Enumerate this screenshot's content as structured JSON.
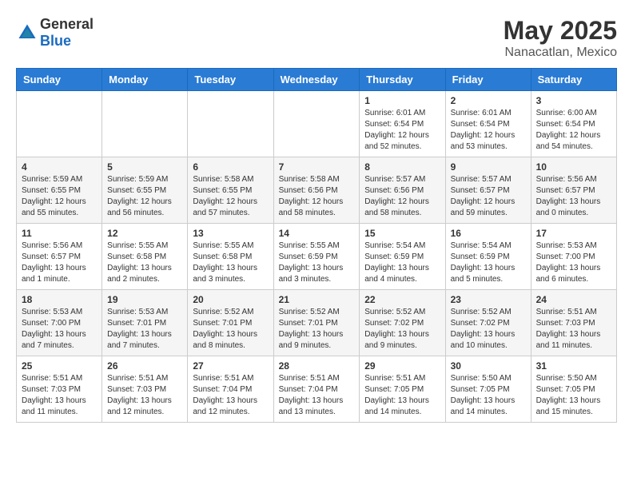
{
  "header": {
    "logo": {
      "general": "General",
      "blue": "Blue"
    },
    "title": "May 2025",
    "location": "Nanacatlan, Mexico"
  },
  "calendar": {
    "days_of_week": [
      "Sunday",
      "Monday",
      "Tuesday",
      "Wednesday",
      "Thursday",
      "Friday",
      "Saturday"
    ],
    "weeks": [
      [
        {
          "day": "",
          "info": ""
        },
        {
          "day": "",
          "info": ""
        },
        {
          "day": "",
          "info": ""
        },
        {
          "day": "",
          "info": ""
        },
        {
          "day": "1",
          "info": "Sunrise: 6:01 AM\nSunset: 6:54 PM\nDaylight: 12 hours\nand 52 minutes."
        },
        {
          "day": "2",
          "info": "Sunrise: 6:01 AM\nSunset: 6:54 PM\nDaylight: 12 hours\nand 53 minutes."
        },
        {
          "day": "3",
          "info": "Sunrise: 6:00 AM\nSunset: 6:54 PM\nDaylight: 12 hours\nand 54 minutes."
        }
      ],
      [
        {
          "day": "4",
          "info": "Sunrise: 5:59 AM\nSunset: 6:55 PM\nDaylight: 12 hours\nand 55 minutes."
        },
        {
          "day": "5",
          "info": "Sunrise: 5:59 AM\nSunset: 6:55 PM\nDaylight: 12 hours\nand 56 minutes."
        },
        {
          "day": "6",
          "info": "Sunrise: 5:58 AM\nSunset: 6:55 PM\nDaylight: 12 hours\nand 57 minutes."
        },
        {
          "day": "7",
          "info": "Sunrise: 5:58 AM\nSunset: 6:56 PM\nDaylight: 12 hours\nand 58 minutes."
        },
        {
          "day": "8",
          "info": "Sunrise: 5:57 AM\nSunset: 6:56 PM\nDaylight: 12 hours\nand 58 minutes."
        },
        {
          "day": "9",
          "info": "Sunrise: 5:57 AM\nSunset: 6:57 PM\nDaylight: 12 hours\nand 59 minutes."
        },
        {
          "day": "10",
          "info": "Sunrise: 5:56 AM\nSunset: 6:57 PM\nDaylight: 13 hours\nand 0 minutes."
        }
      ],
      [
        {
          "day": "11",
          "info": "Sunrise: 5:56 AM\nSunset: 6:57 PM\nDaylight: 13 hours\nand 1 minute."
        },
        {
          "day": "12",
          "info": "Sunrise: 5:55 AM\nSunset: 6:58 PM\nDaylight: 13 hours\nand 2 minutes."
        },
        {
          "day": "13",
          "info": "Sunrise: 5:55 AM\nSunset: 6:58 PM\nDaylight: 13 hours\nand 3 minutes."
        },
        {
          "day": "14",
          "info": "Sunrise: 5:55 AM\nSunset: 6:59 PM\nDaylight: 13 hours\nand 3 minutes."
        },
        {
          "day": "15",
          "info": "Sunrise: 5:54 AM\nSunset: 6:59 PM\nDaylight: 13 hours\nand 4 minutes."
        },
        {
          "day": "16",
          "info": "Sunrise: 5:54 AM\nSunset: 6:59 PM\nDaylight: 13 hours\nand 5 minutes."
        },
        {
          "day": "17",
          "info": "Sunrise: 5:53 AM\nSunset: 7:00 PM\nDaylight: 13 hours\nand 6 minutes."
        }
      ],
      [
        {
          "day": "18",
          "info": "Sunrise: 5:53 AM\nSunset: 7:00 PM\nDaylight: 13 hours\nand 7 minutes."
        },
        {
          "day": "19",
          "info": "Sunrise: 5:53 AM\nSunset: 7:01 PM\nDaylight: 13 hours\nand 7 minutes."
        },
        {
          "day": "20",
          "info": "Sunrise: 5:52 AM\nSunset: 7:01 PM\nDaylight: 13 hours\nand 8 minutes."
        },
        {
          "day": "21",
          "info": "Sunrise: 5:52 AM\nSunset: 7:01 PM\nDaylight: 13 hours\nand 9 minutes."
        },
        {
          "day": "22",
          "info": "Sunrise: 5:52 AM\nSunset: 7:02 PM\nDaylight: 13 hours\nand 9 minutes."
        },
        {
          "day": "23",
          "info": "Sunrise: 5:52 AM\nSunset: 7:02 PM\nDaylight: 13 hours\nand 10 minutes."
        },
        {
          "day": "24",
          "info": "Sunrise: 5:51 AM\nSunset: 7:03 PM\nDaylight: 13 hours\nand 11 minutes."
        }
      ],
      [
        {
          "day": "25",
          "info": "Sunrise: 5:51 AM\nSunset: 7:03 PM\nDaylight: 13 hours\nand 11 minutes."
        },
        {
          "day": "26",
          "info": "Sunrise: 5:51 AM\nSunset: 7:03 PM\nDaylight: 13 hours\nand 12 minutes."
        },
        {
          "day": "27",
          "info": "Sunrise: 5:51 AM\nSunset: 7:04 PM\nDaylight: 13 hours\nand 12 minutes."
        },
        {
          "day": "28",
          "info": "Sunrise: 5:51 AM\nSunset: 7:04 PM\nDaylight: 13 hours\nand 13 minutes."
        },
        {
          "day": "29",
          "info": "Sunrise: 5:51 AM\nSunset: 7:05 PM\nDaylight: 13 hours\nand 14 minutes."
        },
        {
          "day": "30",
          "info": "Sunrise: 5:50 AM\nSunset: 7:05 PM\nDaylight: 13 hours\nand 14 minutes."
        },
        {
          "day": "31",
          "info": "Sunrise: 5:50 AM\nSunset: 7:05 PM\nDaylight: 13 hours\nand 15 minutes."
        }
      ]
    ]
  }
}
